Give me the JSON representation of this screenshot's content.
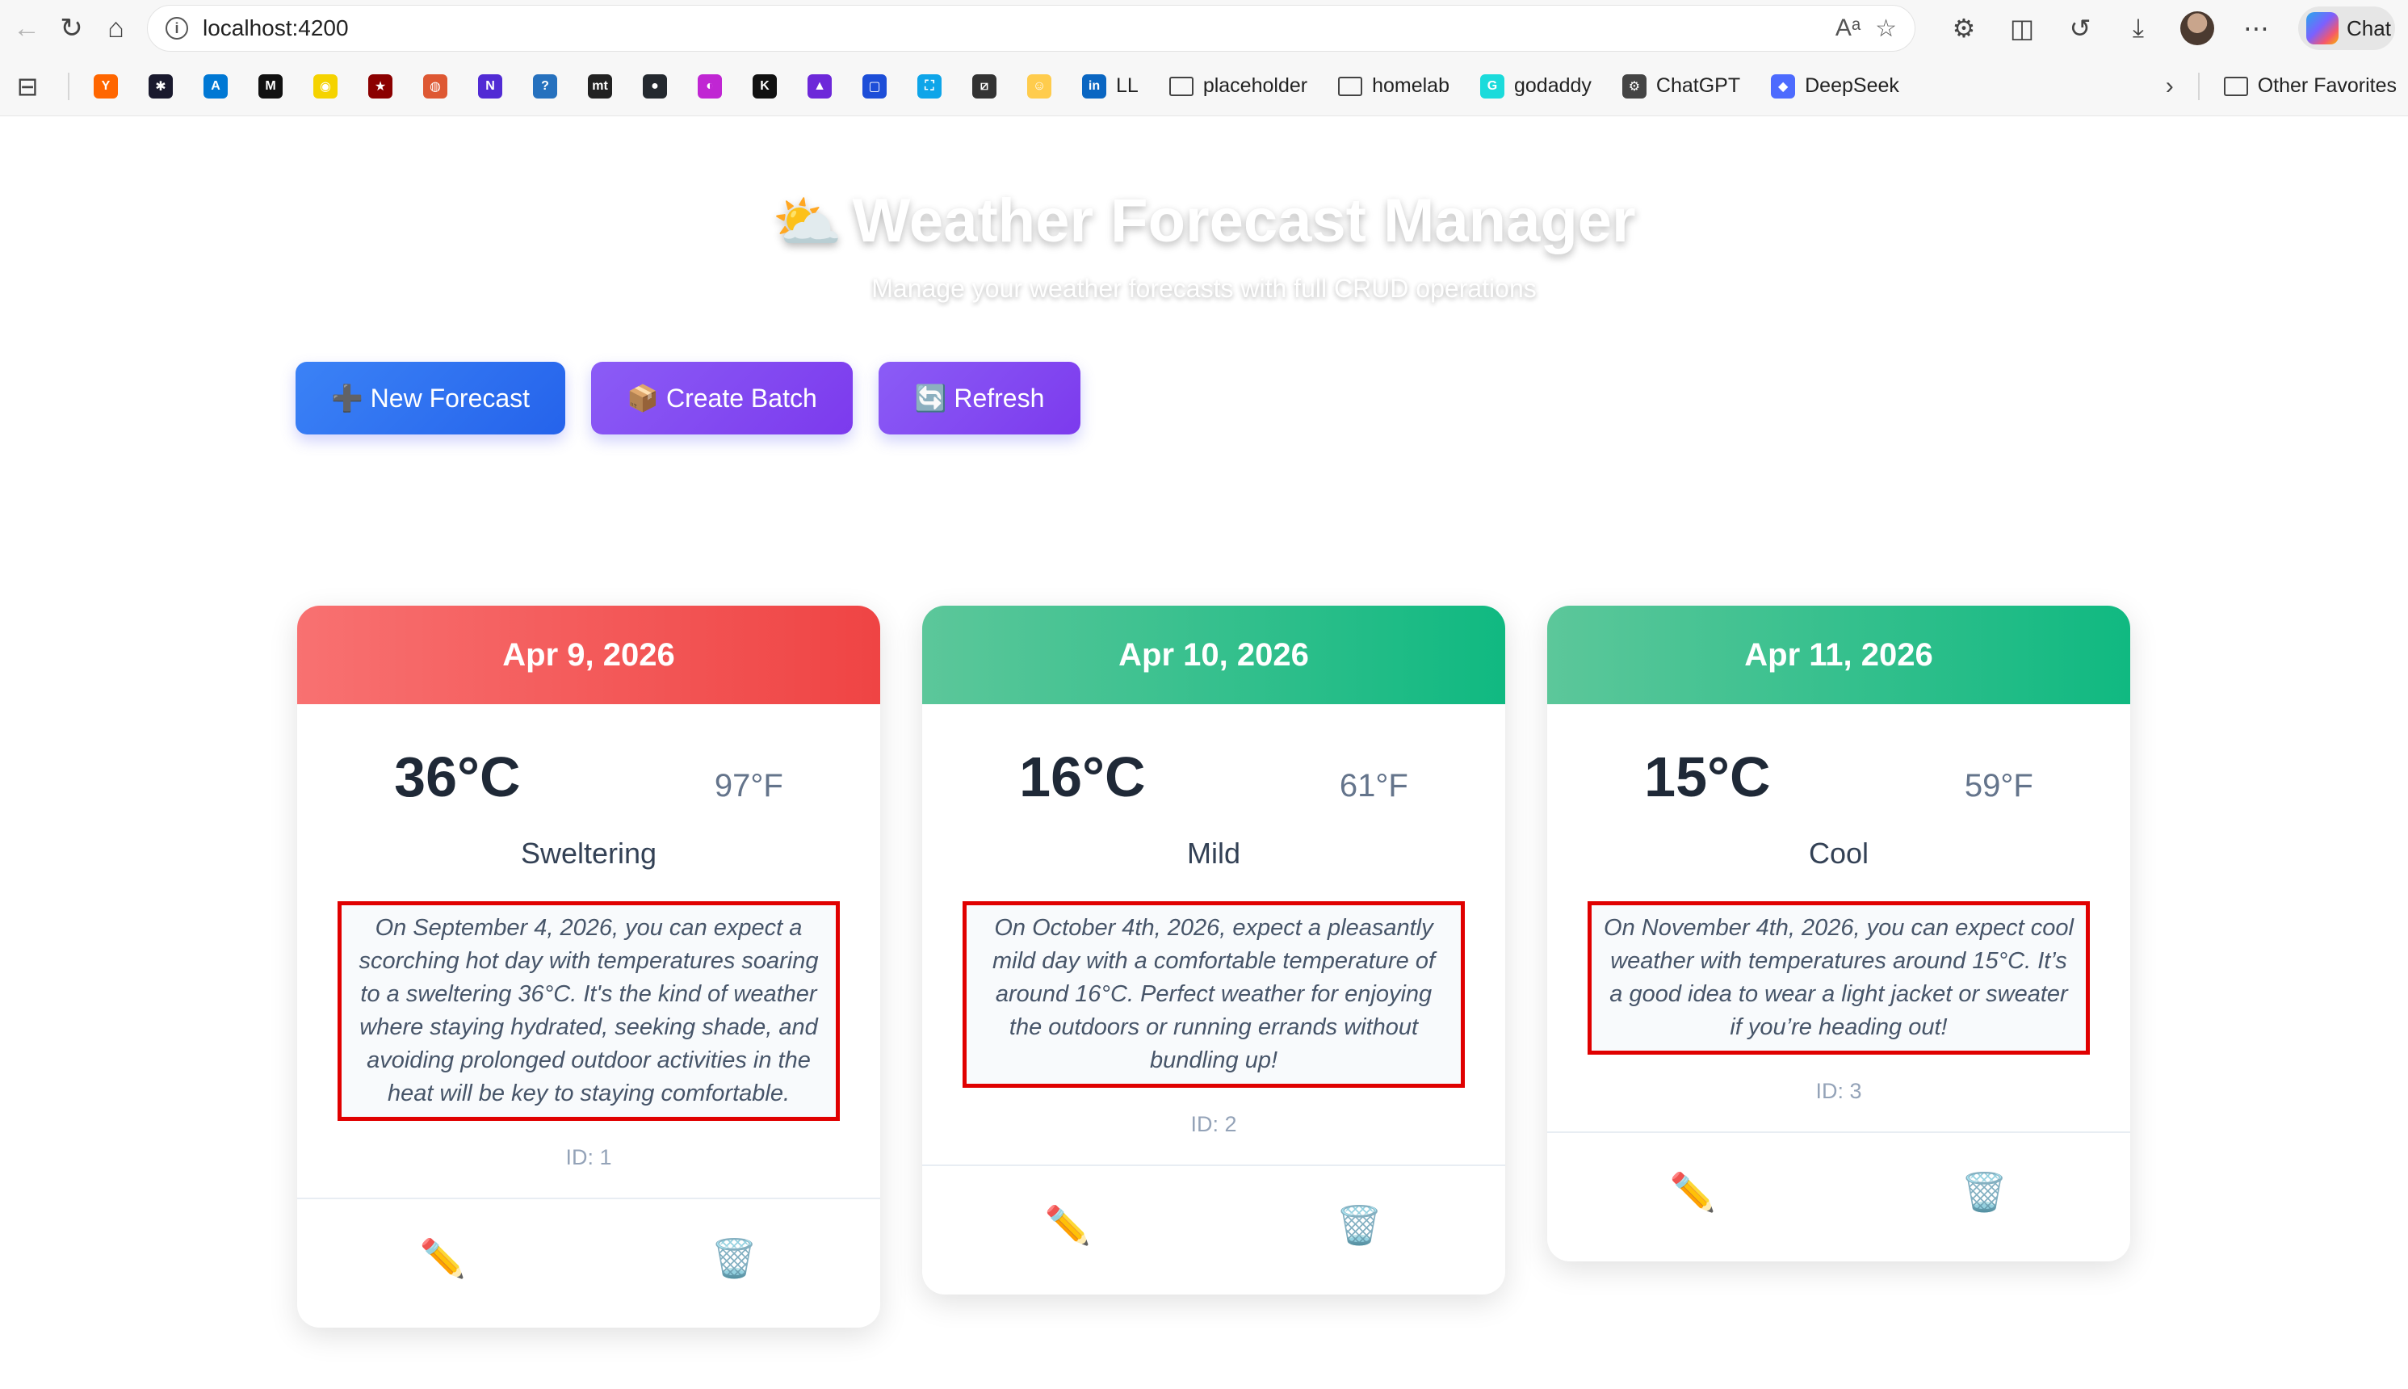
{
  "browser": {
    "url": "localhost:4200",
    "copilot_label": "Chat",
    "bookmarks": [
      {
        "label": "",
        "icon": "y-icon",
        "color": "#ff6600",
        "glyph": "Y"
      },
      {
        "label": "",
        "icon": "sparkle-icon",
        "color": "#1a1a2e",
        "glyph": "✱"
      },
      {
        "label": "",
        "icon": "azure-icon",
        "color": "#0078d4",
        "glyph": "A"
      },
      {
        "label": "",
        "icon": "m-icon",
        "color": "#111111",
        "glyph": "M"
      },
      {
        "label": "",
        "icon": "pin-icon",
        "color": "#f5d300",
        "glyph": "◉"
      },
      {
        "label": "",
        "icon": "star-icon",
        "color": "#8b0000",
        "glyph": "★"
      },
      {
        "label": "",
        "icon": "duckduckgo-icon",
        "color": "#de5833",
        "glyph": "◍"
      },
      {
        "label": "",
        "icon": "dotnet-icon",
        "color": "#512bd4",
        "glyph": "N"
      },
      {
        "label": "",
        "icon": "powershell-icon",
        "color": "#2671be",
        "glyph": "?"
      },
      {
        "label": "",
        "icon": "mt-icon",
        "color": "#222222",
        "glyph": "mt"
      },
      {
        "label": "",
        "icon": "github-icon",
        "color": "#24292f",
        "glyph": "●"
      },
      {
        "label": "",
        "icon": "gradient-icon",
        "color": "#c026d3",
        "glyph": "◐"
      },
      {
        "label": "",
        "icon": "circle-k-icon",
        "color": "#111111",
        "glyph": "K"
      },
      {
        "label": "",
        "icon": "triangle-icon",
        "color": "#6d28d9",
        "glyph": "▲"
      },
      {
        "label": "",
        "icon": "frame-icon",
        "color": "#1d4ed8",
        "glyph": "▢"
      },
      {
        "label": "",
        "icon": "screenshot-icon",
        "color": "#0ea5e9",
        "glyph": "⛶"
      },
      {
        "label": "",
        "icon": "slash-box-icon",
        "color": "#333333",
        "glyph": "⧄"
      },
      {
        "label": "",
        "icon": "huggingface-icon",
        "color": "#ffcc4d",
        "glyph": "☺"
      },
      {
        "label": "LL",
        "icon": "linkedin-icon",
        "color": "#0a66c2",
        "glyph": "in"
      },
      {
        "label": "placeholder",
        "icon": "folder-icon",
        "color": "",
        "glyph": ""
      },
      {
        "label": "homelab",
        "icon": "folder-icon",
        "color": "",
        "glyph": ""
      },
      {
        "label": "godaddy",
        "icon": "godaddy-icon",
        "color": "#1bdbdb",
        "glyph": "G"
      },
      {
        "label": "ChatGPT",
        "icon": "chatgpt-icon",
        "color": "#444444",
        "glyph": "⚙"
      },
      {
        "label": "DeepSeek",
        "icon": "deepseek-icon",
        "color": "#4d6bfe",
        "glyph": "◆"
      }
    ],
    "other_favorites": "Other Favorites"
  },
  "page": {
    "title_emoji": "⛅",
    "title": "Weather Forecast Manager",
    "subtitle": "Manage your weather forecasts with full CRUD operations",
    "actions": {
      "new": "➕ New Forecast",
      "batch": "📦 Create Batch",
      "refresh": "🔄 Refresh"
    }
  },
  "forecasts": [
    {
      "date": "Apr 9, 2026",
      "temp_c": "36°C",
      "temp_f": "97°F",
      "summary": "Sweltering",
      "description": "On September 4, 2026, you can expect a scorching hot day with temperatures soaring to a sweltering 36°C. It's the kind of weather where staying hydrated, seeking shade, and avoiding prolonged outdoor activities in the heat will be key to staying comfortable.",
      "id": "ID: 1",
      "header_color": "#ef4444"
    },
    {
      "date": "Apr 10, 2026",
      "temp_c": "16°C",
      "temp_f": "61°F",
      "summary": "Mild",
      "description": "On October 4th, 2026, expect a pleasantly mild day with a comfortable temperature of around 16°C. Perfect weather for enjoying the outdoors or running errands without bundling up!",
      "id": "ID: 2",
      "header_color": "#10b981"
    },
    {
      "date": "Apr 11, 2026",
      "temp_c": "15°C",
      "temp_f": "59°F",
      "summary": "Cool",
      "description": "On November 4th, 2026, you can expect cool weather with temperatures around 15°C. It’s a good idea to wear a light jacket or sweater if you’re heading out!",
      "id": "ID: 3",
      "header_color": "#10b981"
    }
  ],
  "card_actions": {
    "edit": "✏️",
    "delete": "🗑️"
  }
}
